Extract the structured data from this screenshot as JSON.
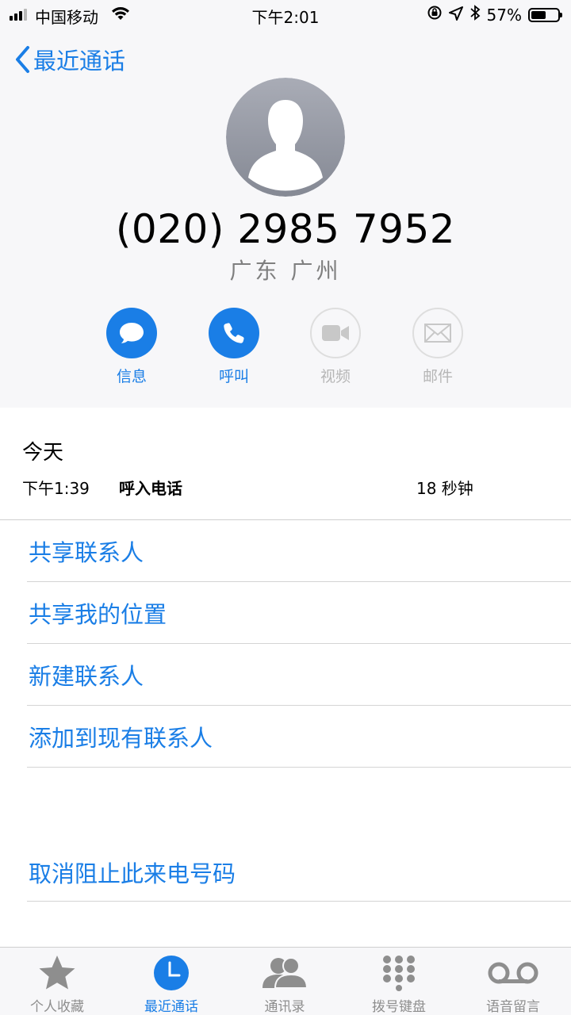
{
  "status_bar": {
    "carrier": "中国移动",
    "time": "下午2:01",
    "battery": "57%",
    "battery_level": 0.57
  },
  "nav": {
    "back_label": "最近通话"
  },
  "contact": {
    "number": "(020) 2985 7952",
    "location": "广东 广州"
  },
  "actions": [
    {
      "label": "信息",
      "icon": "message-icon",
      "enabled": true
    },
    {
      "label": "呼叫",
      "icon": "phone-icon",
      "enabled": true
    },
    {
      "label": "视频",
      "icon": "video-icon",
      "enabled": false
    },
    {
      "label": "邮件",
      "icon": "mail-icon",
      "enabled": false
    }
  ],
  "history": {
    "date": "今天",
    "time": "下午1:39",
    "type": "呼入电话",
    "duration": "18 秒钟"
  },
  "options": [
    "共享联系人",
    "共享我的位置",
    "新建联系人",
    "添加到现有联系人"
  ],
  "block_option": "取消阻止此来电号码",
  "tabs": [
    {
      "label": "个人收藏",
      "icon": "star-icon",
      "active": false
    },
    {
      "label": "最近通话",
      "icon": "clock-icon",
      "active": true
    },
    {
      "label": "通讯录",
      "icon": "contacts-icon",
      "active": false
    },
    {
      "label": "拨号键盘",
      "icon": "keypad-icon",
      "active": false
    },
    {
      "label": "语音留言",
      "icon": "voicemail-icon",
      "active": false
    }
  ],
  "colors": {
    "accent": "#1a7ee6",
    "disabled": "#b6b6b6",
    "header_bg": "#f7f7f9"
  }
}
